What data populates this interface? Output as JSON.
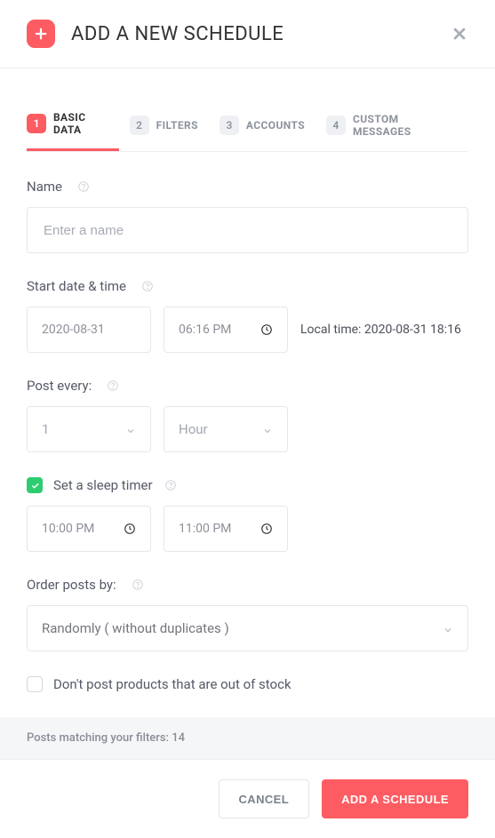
{
  "header": {
    "title": "ADD A NEW SCHEDULE"
  },
  "tabs": [
    {
      "num": "1",
      "label": "BASIC DATA",
      "active": true
    },
    {
      "num": "2",
      "label": "FILTERS",
      "active": false
    },
    {
      "num": "3",
      "label": "ACCOUNTS",
      "active": false
    },
    {
      "num": "4",
      "label": "CUSTOM MESSAGES",
      "active": false
    }
  ],
  "form": {
    "name": {
      "label": "Name",
      "placeholder": "Enter a name",
      "value": ""
    },
    "startDate": {
      "label": "Start date & time",
      "date": "2020-08-31",
      "time": "06:16 PM",
      "localTimeLabel": "Local time: 2020-08-31 18:16"
    },
    "postEvery": {
      "label": "Post every:",
      "interval": "1",
      "unit": "Hour"
    },
    "sleepTimer": {
      "label": "Set a sleep timer",
      "checked": true,
      "start": "10:00 PM",
      "end": "11:00 PM"
    },
    "orderBy": {
      "label": "Order posts by:",
      "value": "Randomly ( without duplicates )"
    },
    "outOfStock": {
      "label": "Don't post products that are out of stock",
      "checked": false
    }
  },
  "footer": {
    "info": "Posts matching your filters: 14",
    "cancel": "CANCEL",
    "submit": "ADD A SCHEDULE"
  }
}
